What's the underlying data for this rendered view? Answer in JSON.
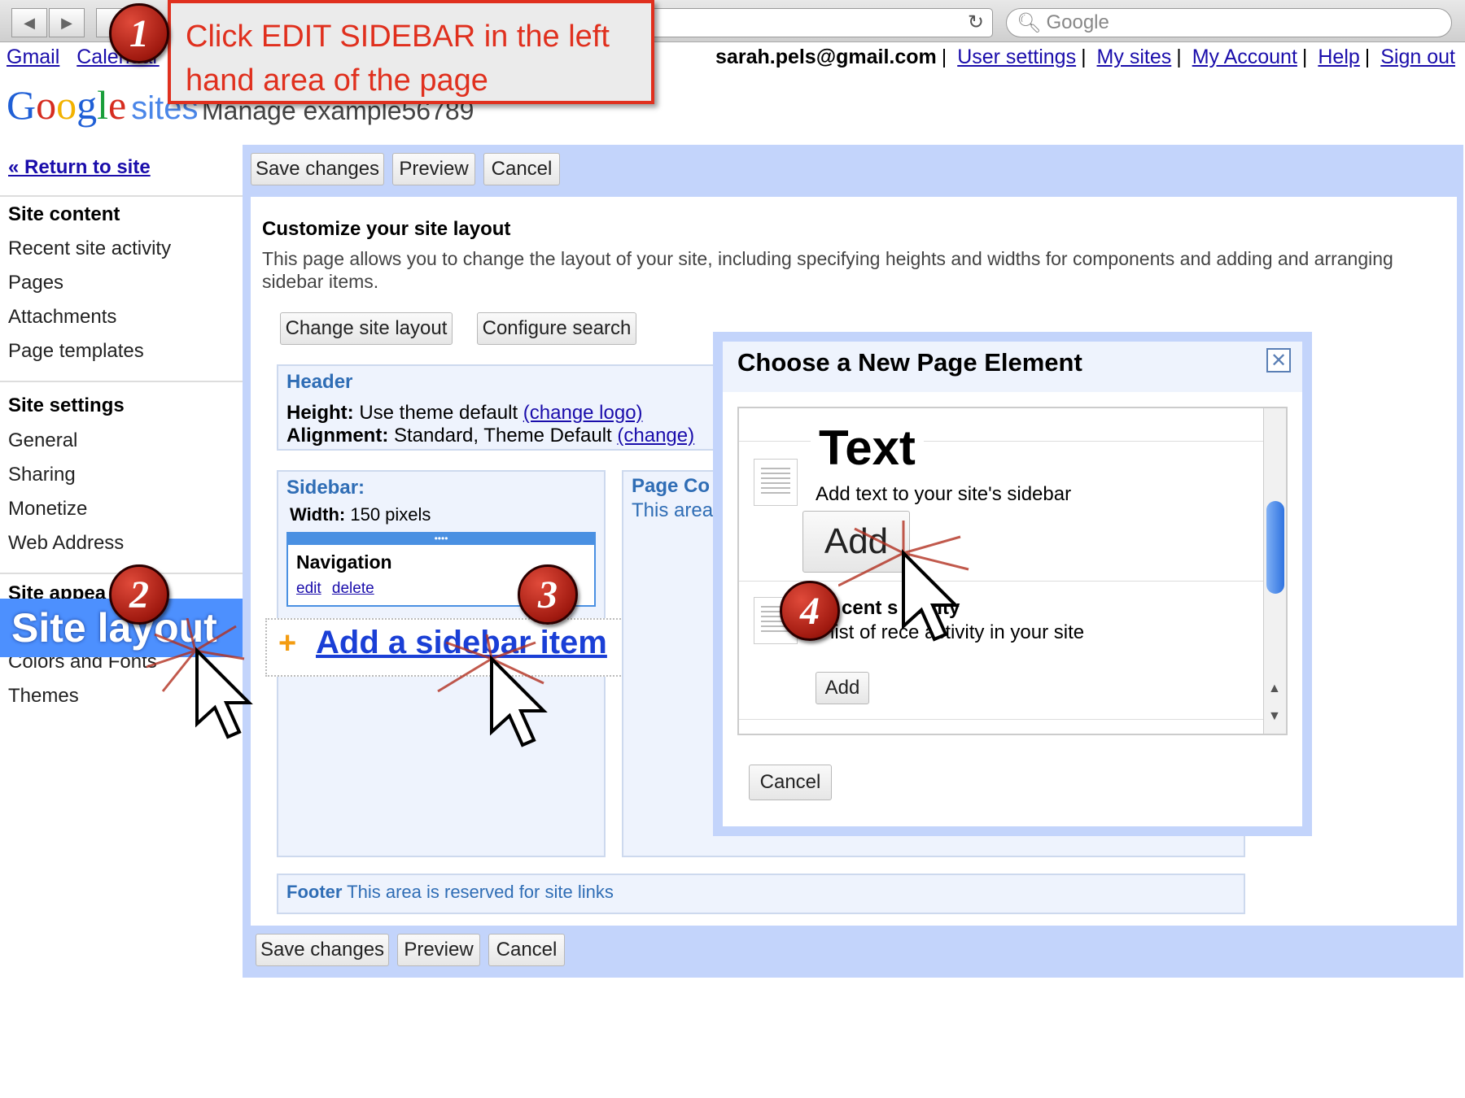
{
  "browser": {
    "search_placeholder": "Google"
  },
  "topnav": {
    "left_links": [
      "Gmail",
      "Calendar"
    ],
    "email": "sarah.pels@gmail.com",
    "right_links": [
      "User settings",
      "My sites",
      "My Account",
      "Help",
      "Sign out"
    ]
  },
  "header": {
    "logo_text": "Google",
    "logo_sites": "sites",
    "manage_title": "Manage example56789"
  },
  "leftnav": {
    "return_link": "« Return to site",
    "site_content_heading": "Site content",
    "site_content_items": [
      "Recent site activity",
      "Pages",
      "Attachments",
      "Page templates"
    ],
    "site_settings_heading": "Site settings",
    "site_settings_items": [
      "General",
      "Sharing",
      "Monetize",
      "Web Address"
    ],
    "site_appearance_heading": "Site appea",
    "site_layout_label": "Site layout",
    "appearance_items": [
      "Colors and Fonts",
      "Themes"
    ]
  },
  "toolbar": {
    "save_label": "Save changes",
    "preview_label": "Preview",
    "cancel_label": "Cancel"
  },
  "main": {
    "title": "Customize your site layout",
    "description": "This page allows you to change the layout of your site, including specifying heights and widths for components and adding and arranging sidebar items.",
    "change_layout_label": "Change site layout",
    "configure_search_label": "Configure search",
    "header_box": {
      "title": "Header",
      "height_label": "Height:",
      "height_value": "Use theme default",
      "height_link": "(change logo)",
      "alignment_label": "Alignment:",
      "alignment_value": "Standard, Theme Default",
      "alignment_link": "(change)"
    },
    "sidebar_box": {
      "title": "Sidebar:",
      "width_label": "Width:",
      "width_value": "150 pixels",
      "nav_title": "Navigation",
      "edit_link": "edit",
      "delete_link": "delete",
      "add_item_label": "Add a sidebar item"
    },
    "page_content_box": {
      "title": "Page Co",
      "desc": "This area"
    },
    "footer_box": {
      "title": "Footer",
      "desc": "This area is reserved for site links"
    }
  },
  "dialog": {
    "title": "Choose a New Page Element",
    "items": [
      {
        "title": "Text",
        "desc": "Add text to your site's sidebar",
        "add_label": "Add"
      },
      {
        "title": "cent s  ctivity",
        "desc": " list of rece   activity in your site",
        "add_label": "Add"
      }
    ],
    "cancel_label": "Cancel"
  },
  "annotations": {
    "callout_text": "Click EDIT SIDEBAR in the left hand area of the page",
    "badges": [
      "1",
      "2",
      "3",
      "4"
    ],
    "accent_color": "#e0301e"
  }
}
